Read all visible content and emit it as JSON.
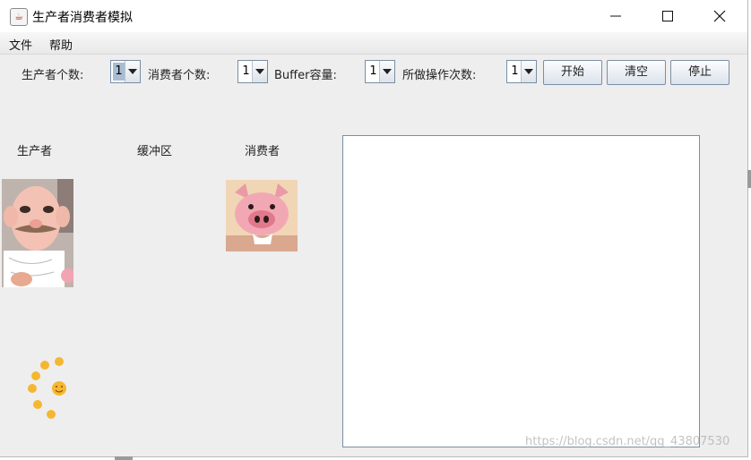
{
  "window": {
    "title": "生产者消费者模拟",
    "icon": "java-cup-icon",
    "controls": [
      "minimize",
      "maximize",
      "close"
    ]
  },
  "menu": [
    {
      "label": "文件"
    },
    {
      "label": "帮助"
    }
  ],
  "toolbar": {
    "producer_count_label": "生产者个数:",
    "producer_count_value": "1",
    "consumer_count_label": "消费者个数:",
    "consumer_count_value": "1",
    "buffer_capacity_label": "Buffer容量:",
    "buffer_capacity_value": "1",
    "operation_count_label": "所做操作次数:",
    "operation_count_value": "1",
    "start_label": "开始",
    "clear_label": "清空",
    "stop_label": "停止"
  },
  "sections": {
    "producer": "生产者",
    "buffer": "缓冲区",
    "consumer": "消费者"
  },
  "images": {
    "producer": "cartoon-man-portrait",
    "consumer": "cartoon-pig-portrait",
    "buffer_items": "smiley-faces-icon"
  },
  "log": {
    "content": ""
  },
  "watermark": "https://blog.csdn.net/qq_43807530",
  "colors": {
    "window_bg": "#eeeeee",
    "combo_border": "#7a8ea4",
    "combo_selected": "#a9bdd2",
    "smiley": "#f5b731"
  }
}
